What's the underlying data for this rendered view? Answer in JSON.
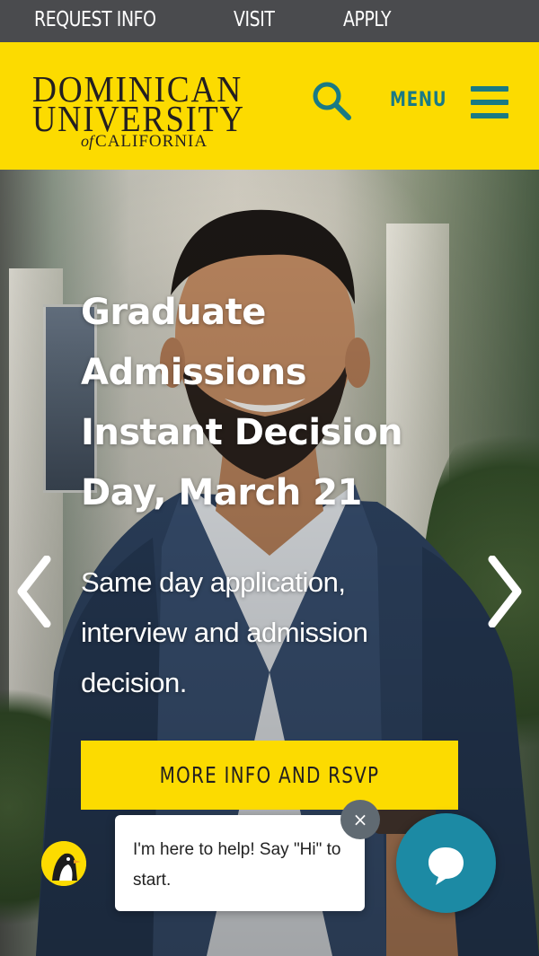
{
  "utility_nav": {
    "items": [
      {
        "label": "REQUEST INFO"
      },
      {
        "label": "VISIT"
      },
      {
        "label": "APPLY"
      }
    ]
  },
  "header": {
    "logo": {
      "line1": "DOMINICAN",
      "line2": "UNIVERSITY",
      "line3_prefix": "of",
      "line3": "CALIFORNIA"
    },
    "search_icon": "search-icon",
    "menu_label": "MENU",
    "menu_icon": "hamburger-icon"
  },
  "hero": {
    "title": "Graduate Admissions Instant Decision Day, March 21",
    "description": "Same day application, interview and admission decision.",
    "cta_label": "MORE INFO AND RSVP",
    "prev_icon": "chevron-left-icon",
    "next_icon": "chevron-right-icon"
  },
  "chat": {
    "message": "I'm here to help! Say \"Hi\" to start.",
    "close_glyph": "×",
    "launcher_icon": "chat-bubble-icon"
  },
  "colors": {
    "brand_yellow": "#fcdb00",
    "brand_teal": "#1a7a84",
    "utility_bar": "#4a4b4e",
    "chat_blue": "#1c8aa4"
  }
}
